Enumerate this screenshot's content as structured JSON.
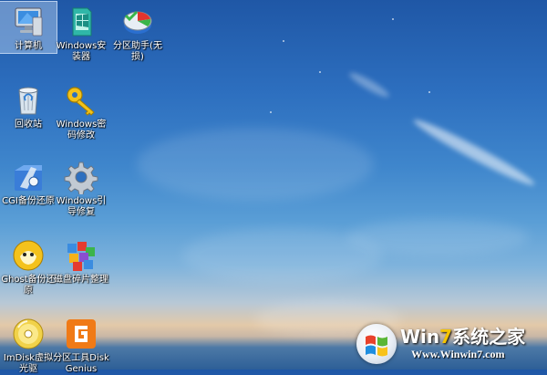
{
  "desktop": {
    "icons": [
      {
        "label": "计算机",
        "icon": "computer-icon"
      },
      {
        "label": "Windows安装器",
        "icon": "installer-icon"
      },
      {
        "label": "分区助手(无损)",
        "icon": "partition-assistant-icon"
      },
      {
        "label": "回收站",
        "icon": "recycle-bin-icon"
      },
      {
        "label": "Windows密码修改",
        "icon": "key-icon"
      },
      {
        "label": "CGI备份还原",
        "icon": "cgi-backup-icon"
      },
      {
        "label": "Windows引导修复",
        "icon": "gear-icon"
      },
      {
        "label": "Ghost备份还原",
        "icon": "ghost-icon"
      },
      {
        "label": "磁盘碎片整理",
        "icon": "defrag-icon"
      },
      {
        "label": "ImDisk虚拟光驱",
        "icon": "virtual-disc-icon"
      },
      {
        "label": "分区工具DiskGenius",
        "icon": "diskgenius-icon"
      }
    ]
  },
  "watermark": {
    "title_prefix": "Win",
    "title_accent": "7",
    "title_suffix": "系统之家",
    "url": "Www.Winwin7.com"
  },
  "colors": {
    "sky_top": "#1f57a6",
    "sky_mid": "#5a9ed6",
    "horizon": "#e3c9a8",
    "sea": "#2d5f97",
    "selection": "#bed7f5"
  }
}
